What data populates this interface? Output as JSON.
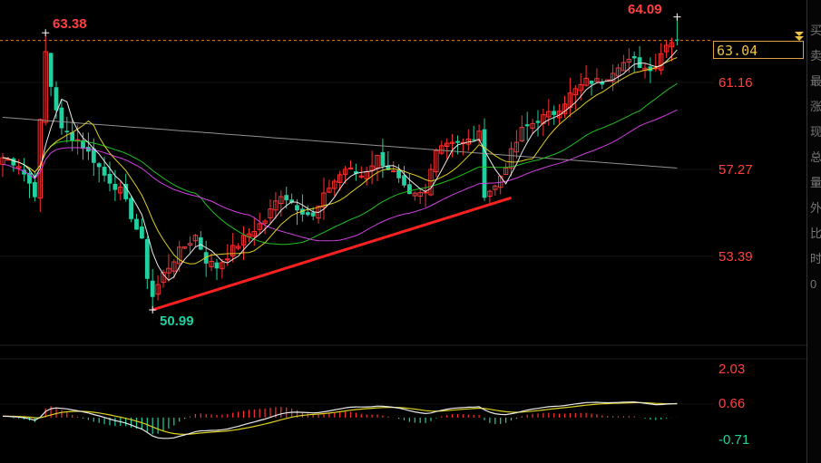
{
  "chart_data": [
    {
      "type": "candlestick",
      "price_axis_ticks": [
        "61.16",
        "57.27",
        "53.39"
      ],
      "high_label": "63.38",
      "recent_high_label": "64.09",
      "low_label": "50.99",
      "current_price": "63.04",
      "colors": {
        "up": "#ff3030",
        "down": "#20d0a0",
        "ma_white": "#e8e8e8",
        "ma_yellow": "#e0d020",
        "ma_green": "#20c020",
        "ma_purple": "#d040e0",
        "ma_gray": "#909090",
        "trendline": "#ff2020",
        "ref_line": "#e08020"
      },
      "trendline": {
        "from_price": 50.99,
        "to_price": 56.0
      },
      "moving_average_colors": [
        "white",
        "yellow",
        "green",
        "purple",
        "gray"
      ]
    },
    {
      "type": "macd",
      "axis_ticks": [
        "2.03",
        "0.66",
        "-0.71"
      ],
      "colors": {
        "dif": "#e8e8e8",
        "dea": "#e0d020",
        "hist_up": "#ff3030",
        "hist_down": "#20d0a0"
      }
    }
  ],
  "side_panel": {
    "text": "买卖最涨现总量外比时0"
  }
}
